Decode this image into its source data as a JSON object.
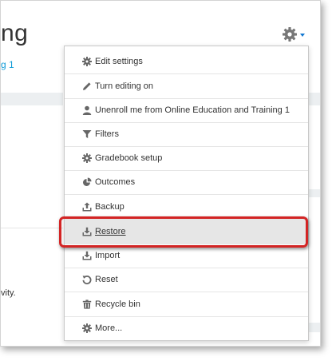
{
  "page": {
    "title": "ng",
    "breadcrumb": "g 1",
    "background_text": "vity."
  },
  "menu": {
    "items": [
      {
        "label": "Edit settings",
        "icon": "gear-icon"
      },
      {
        "label": "Turn editing on",
        "icon": "pencil-icon"
      },
      {
        "label": "Unenroll me from Online Education and Training 1",
        "icon": "user-icon"
      },
      {
        "label": "Filters",
        "icon": "filter-icon"
      },
      {
        "label": "Gradebook setup",
        "icon": "gear-icon"
      },
      {
        "label": "Outcomes",
        "icon": "pie-chart-icon"
      },
      {
        "label": "Backup",
        "icon": "upload-icon"
      },
      {
        "label": "Restore",
        "icon": "download-icon",
        "highlighted": true
      },
      {
        "label": "Import",
        "icon": "download-icon"
      },
      {
        "label": "Reset",
        "icon": "refresh-icon"
      },
      {
        "label": "Recycle bin",
        "icon": "trash-icon"
      },
      {
        "label": "More...",
        "icon": "gear-icon"
      }
    ]
  },
  "colors": {
    "link": "#0f9bd7",
    "accent": "#1177d1",
    "highlight_outline": "#d32424",
    "icon": "#555555"
  }
}
